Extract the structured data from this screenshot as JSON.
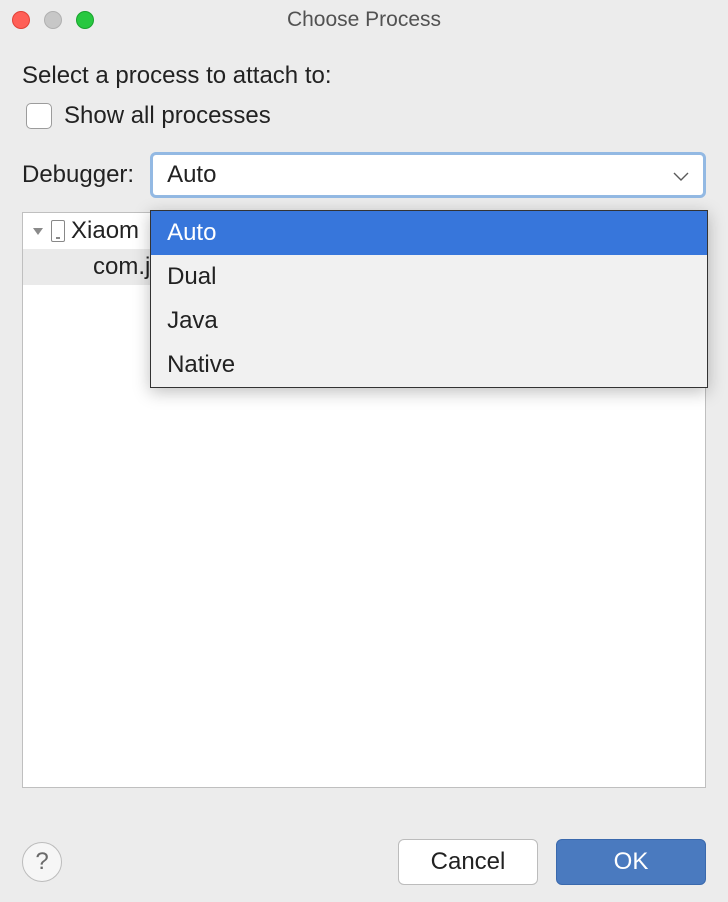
{
  "window": {
    "title": "Choose Process"
  },
  "heading": "Select a process to attach to:",
  "checkbox": {
    "label": "Show all processes",
    "checked": false
  },
  "debugger": {
    "label": "Debugger:",
    "selected": "Auto",
    "options": [
      "Auto",
      "Dual",
      "Java",
      "Native"
    ]
  },
  "tree": {
    "device": "Xiaom",
    "process": "com.j"
  },
  "footer": {
    "cancel": "Cancel",
    "ok": "OK",
    "help": "?"
  }
}
